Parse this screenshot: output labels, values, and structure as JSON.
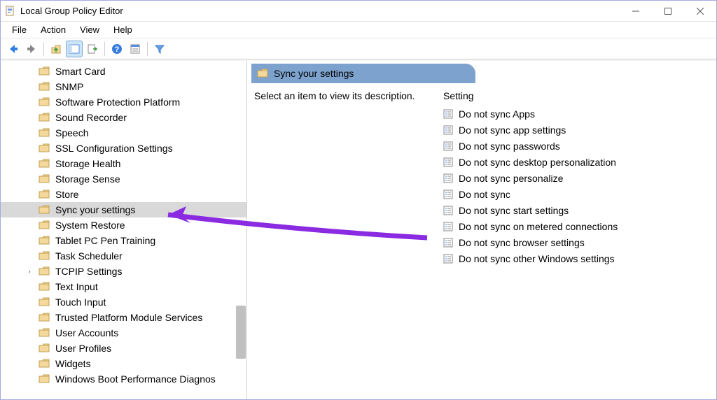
{
  "window": {
    "title": "Local Group Policy Editor"
  },
  "menubar": {
    "items": [
      "File",
      "Action",
      "View",
      "Help"
    ]
  },
  "tree": {
    "items": [
      {
        "label": "Smart Card"
      },
      {
        "label": "SNMP"
      },
      {
        "label": "Software Protection Platform"
      },
      {
        "label": "Sound Recorder"
      },
      {
        "label": "Speech"
      },
      {
        "label": "SSL Configuration Settings"
      },
      {
        "label": "Storage Health"
      },
      {
        "label": "Storage Sense"
      },
      {
        "label": "Store"
      },
      {
        "label": "Sync your settings",
        "selected": true
      },
      {
        "label": "System Restore"
      },
      {
        "label": "Tablet PC Pen Training"
      },
      {
        "label": "Task Scheduler"
      },
      {
        "label": "TCPIP Settings",
        "expandable": true
      },
      {
        "label": "Text Input"
      },
      {
        "label": "Touch Input"
      },
      {
        "label": "Trusted Platform Module Services"
      },
      {
        "label": "User Accounts"
      },
      {
        "label": "User Profiles"
      },
      {
        "label": "Widgets"
      },
      {
        "label": "Windows Boot Performance Diagnos"
      }
    ]
  },
  "content": {
    "header": "Sync your settings",
    "description": "Select an item to view its description.",
    "column_header": "Setting",
    "settings": [
      "Do not sync Apps",
      "Do not sync app settings",
      "Do not sync passwords",
      "Do not sync desktop personalization",
      "Do not sync personalize",
      "Do not sync",
      "Do not sync start settings",
      "Do not sync on metered connections",
      "Do not sync browser settings",
      "Do not sync other Windows settings"
    ]
  }
}
